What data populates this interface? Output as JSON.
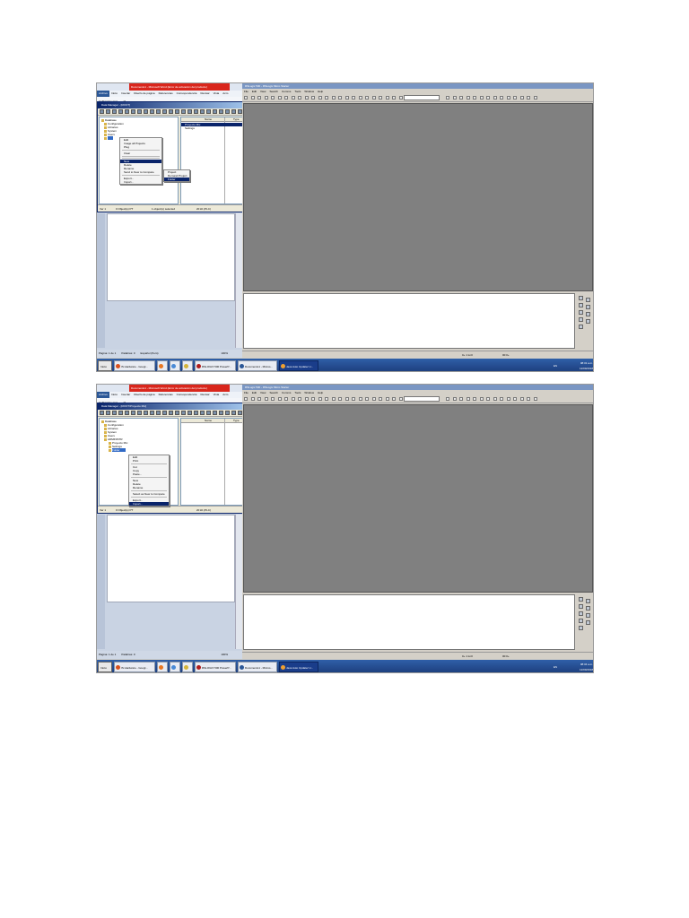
{
  "screenshots": [
    {
      "id": "shot1",
      "word": {
        "title": "Documento1 - Microsoft Word (Error de activación del producto)",
        "tabs": [
          "Archivo",
          "Inicio",
          "Insertar",
          "Diseño de página",
          "Referencias",
          "Correspondencia",
          "Revisar",
          "Vista",
          "Acro"
        ],
        "font_name": "Calibri (Cuerpo)",
        "font_size": "11",
        "status_items": [
          "Página: 1 de 1",
          "Palabras: 0",
          "Español (Perú)"
        ],
        "zoom": "100%"
      },
      "data_manager": {
        "title": "Data Manager - [ROOT]",
        "tree": [
          {
            "label": "Database",
            "level": 0
          },
          {
            "label": "Configuration",
            "level": 1
          },
          {
            "label": "Libraries",
            "level": 1
          },
          {
            "label": "System",
            "level": 1
          },
          {
            "label": "Users",
            "level": 1
          },
          {
            "label": "",
            "level": 1,
            "selected": true
          }
        ],
        "list_columns": [
          "Name",
          "Type"
        ],
        "list_rows": [
          {
            "name": "Proyecto Mix",
            "selected": true
          },
          {
            "name": "Settings",
            "selected": false
          }
        ],
        "status": [
          "Ver 1",
          "0 Object(s) PT",
          "1 object(s) selected",
          "20 kb (PLC)"
        ]
      },
      "context_menu": {
        "items": [
          "Edit",
          "Image all Projects",
          "Plug",
          "",
          "Clear",
          "",
          "",
          "New",
          "Delete",
          "Rename",
          "Send to New to Compare",
          "",
          "Export...",
          "Import..."
        ],
        "highlight_index": 7
      },
      "submenu": {
        "items": [
          "Project",
          "Demand Project",
          "Folder"
        ],
        "highlight_index": 2
      },
      "rslogix": {
        "title": "RSLogix 500 - RSLogix Micro Starter",
        "menu": [
          "File",
          "Edit",
          "View",
          "Search",
          "Comms",
          "Tools",
          "Window",
          "Help"
        ],
        "status": [
          "",
          "0+ 1:Ln0",
          "00:0+"
        ]
      },
      "taskbar": {
        "start": "Inicio",
        "tasks": [
          {
            "label": "IS Hardware - Googl...",
            "dark": false,
            "color": "#d9501c"
          },
          {
            "label": "",
            "dark": false,
            "color": "#e87722"
          },
          {
            "label": "",
            "dark": false,
            "color": "#4a8ad6"
          },
          {
            "label": "",
            "dark": false,
            "color": "#d4b43a"
          },
          {
            "label": "RSLOGIX 500 PowerP...",
            "dark": false,
            "color": "#b01c1c"
          },
          {
            "label": "Documento1 - Micros...",
            "dark": false,
            "color": "#2b5797"
          },
          {
            "label": "Java Auto Updater U...",
            "dark": true,
            "color": "#f0a030"
          }
        ],
        "lang": "ES",
        "time": "08:31 a.m.",
        "date": "12/09/2018"
      }
    },
    {
      "id": "shot2",
      "word": {
        "title": "Documento1 - Microsoft Word (Error de activación del producto)",
        "tabs": [
          "Archivo",
          "Inicio",
          "Insertar",
          "Diseño de página",
          "Referencias",
          "Correspondencia",
          "Revisar",
          "Vista",
          "Acro"
        ],
        "font_name": "Calibri (Cuerpo)",
        "font_size": "11",
        "status_items": [
          "Página: 1 de 1",
          "Palabras: 0",
          ""
        ],
        "zoom": "100%"
      },
      "data_manager": {
        "title": "Data Manager - [ROOT\\Proyecto Mix]",
        "tree": [
          {
            "label": "Database",
            "level": 0
          },
          {
            "label": "Configuration",
            "level": 1
          },
          {
            "label": "Libraries",
            "level": 1
          },
          {
            "label": "System",
            "level": 1
          },
          {
            "label": "Users",
            "level": 1
          },
          {
            "label": "ADMINISTR",
            "level": 1
          },
          {
            "label": "Proyecto Mix",
            "level": 2
          },
          {
            "label": "Settings",
            "level": 2
          },
          {
            "label": "Folder",
            "level": 2,
            "selected": true
          }
        ],
        "list_columns": [
          "Name",
          "Type"
        ],
        "list_rows": [],
        "status": [
          "Ver 1",
          "0 Object(s) PT",
          "",
          "20 kb (PLC)"
        ]
      },
      "context_menu": {
        "items": [
          "Edit",
          "Print",
          "",
          "Cut",
          "Copy",
          "Paste...",
          "",
          "New",
          "Delete",
          "Rename",
          "",
          "Select as New to Compare",
          "",
          "Export...",
          "Import..."
        ],
        "highlight_index": 14
      },
      "rslogix": {
        "title": "RSLogix 500 - RSLogix Micro Starter",
        "menu": [
          "File",
          "Edit",
          "View",
          "Search",
          "Comms",
          "Tools",
          "Window",
          "Help"
        ],
        "status": [
          "",
          "0+ 1:Ln0",
          "00:0+"
        ]
      },
      "taskbar": {
        "start": "Inicio",
        "tasks": [
          {
            "label": "IS Hardware - Googl...",
            "dark": false,
            "color": "#d9501c"
          },
          {
            "label": "",
            "dark": false,
            "color": "#e87722"
          },
          {
            "label": "",
            "dark": false,
            "color": "#4a8ad6"
          },
          {
            "label": "",
            "dark": false,
            "color": "#d4b43a"
          },
          {
            "label": "RSLOGIX 500 PowerP...",
            "dark": false,
            "color": "#b01c1c"
          },
          {
            "label": "Documento1 - Micros...",
            "dark": false,
            "color": "#2b5797"
          },
          {
            "label": "Java Auto Updater U...",
            "dark": true,
            "color": "#f0a030"
          }
        ],
        "lang": "ES",
        "time": "08:34 a.m.",
        "date": "12/09/2018"
      }
    }
  ]
}
